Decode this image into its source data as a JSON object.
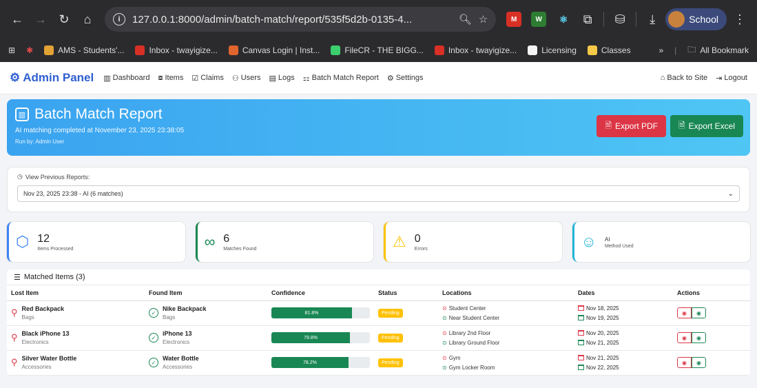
{
  "browser": {
    "url": "127.0.0.1:8000/admin/batch-match/report/535f5d2b-0135-4...",
    "profile": "School",
    "bookmarks": [
      {
        "label": "AMS - Students'...",
        "color": "#e3a234"
      },
      {
        "label": "Inbox - twayigize...",
        "color": "#d93025"
      },
      {
        "label": "Canvas Login | Inst...",
        "color": "#e0642d"
      },
      {
        "label": "FileCR - THE BIGG...",
        "color": "#3ccf6e"
      },
      {
        "label": "Inbox - twayigize...",
        "color": "#d93025"
      },
      {
        "label": "Licensing",
        "color": "#f4f4f4"
      },
      {
        "label": "Classes",
        "color": "#f7c948"
      }
    ],
    "all_bookmarks": "All Bookmark"
  },
  "navbar": {
    "brand": "Admin Panel",
    "items": [
      {
        "label": "Dashboard",
        "icon": "bar-chart-icon"
      },
      {
        "label": "Items",
        "icon": "box-icon"
      },
      {
        "label": "Claims",
        "icon": "clipboard-icon"
      },
      {
        "label": "Users",
        "icon": "users-icon"
      },
      {
        "label": "Logs",
        "icon": "log-icon"
      },
      {
        "label": "Batch Match Report",
        "icon": "hierarchy-icon"
      },
      {
        "label": "Settings",
        "icon": "gear-icon"
      }
    ],
    "back_to_site": "Back to Site",
    "logout": "Logout"
  },
  "hero": {
    "title": "Batch Match Report",
    "subtitle": "AI matching completed at November 23, 2025 23:38:05",
    "run_by": "Run by: Admin User",
    "export_pdf": "Export PDF",
    "export_excel": "Export Excel"
  },
  "previous": {
    "label": "View Previous Reports:",
    "selected": "Nov 23, 2025 23:38 - AI (6 matches)"
  },
  "stats": [
    {
      "value": "12",
      "label": "Items Processed",
      "color": "#3b82f6",
      "icon": "box-icon"
    },
    {
      "value": "6",
      "label": "Matches Found",
      "color": "#198754",
      "icon": "link-icon"
    },
    {
      "value": "0",
      "label": "Errors",
      "color": "#ffc107",
      "icon": "warning-icon"
    },
    {
      "value": "AI",
      "label": "Method Used",
      "color": "#22b5d8",
      "icon": "robot-icon"
    }
  ],
  "matched": {
    "heading": "Matched Items (3)",
    "columns": [
      "Lost Item",
      "Found Item",
      "Confidence",
      "Status",
      "Locations",
      "Dates",
      "Actions"
    ],
    "rows": [
      {
        "lost_name": "Red Backpack",
        "lost_cat": "Bags",
        "found_name": "Nike Backpack",
        "found_cat": "Bags",
        "confidence": "81.8%",
        "confidence_value": 81.8,
        "status": "Pending",
        "loc_lost": "Student Center",
        "loc_found": "Near Student Center",
        "date_lost": "Nov 18, 2025",
        "date_found": "Nov 19, 2025"
      },
      {
        "lost_name": "Black iPhone 13",
        "lost_cat": "Electronics",
        "found_name": "iPhone 13",
        "found_cat": "Electronics",
        "confidence": "79.8%",
        "confidence_value": 79.8,
        "status": "Pending",
        "loc_lost": "Library 2nd Floor",
        "loc_found": "Library Ground Floor",
        "date_lost": "Nov 20, 2025",
        "date_found": "Nov 21, 2025"
      },
      {
        "lost_name": "Silver Water Bottle",
        "lost_cat": "Accessories",
        "found_name": "Water Bottle",
        "found_cat": "Accessories",
        "confidence": "78.2%",
        "confidence_value": 78.2,
        "status": "Pending",
        "loc_lost": "Gym",
        "loc_found": "Gym Locker Room",
        "date_lost": "Nov 21, 2025",
        "date_found": "Nov 22, 2025"
      }
    ]
  }
}
